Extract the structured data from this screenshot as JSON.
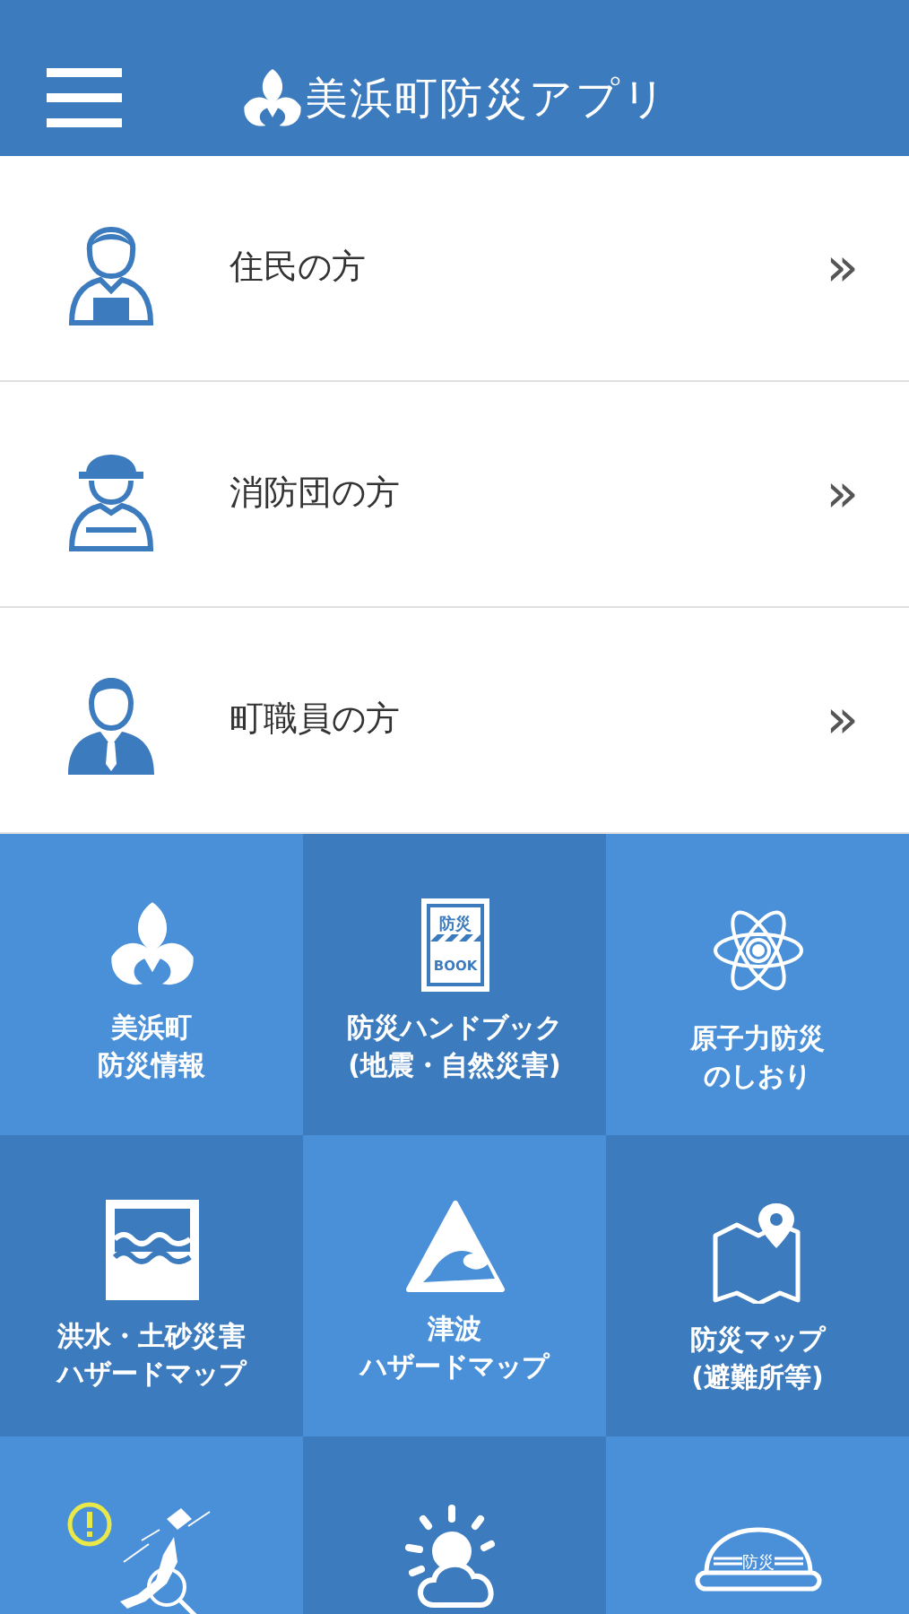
{
  "header": {
    "title": "美浜町防災アプリ"
  },
  "menu": [
    {
      "kind": "resident",
      "label": "住民の方",
      "chevron": "»"
    },
    {
      "kind": "firefighter",
      "label": "消防団の方",
      "chevron": "»"
    },
    {
      "kind": "staff",
      "label": "町職員の方",
      "chevron": "»"
    }
  ],
  "tiles": [
    {
      "kind": "emblem",
      "lines": [
        "美浜町",
        "防災情報"
      ]
    },
    {
      "kind": "book",
      "icon_text": [
        "防災",
        "BOOK"
      ],
      "lines": [
        "防災ハンドブック",
        "(地震・自然災害)"
      ]
    },
    {
      "kind": "atom",
      "lines": [
        "原子力防災",
        "のしおり"
      ]
    },
    {
      "kind": "flood",
      "lines": [
        "洪水・土砂災害",
        "ハザードマップ"
      ]
    },
    {
      "kind": "tsunami",
      "lines": [
        "津波",
        "ハザードマップ"
      ]
    },
    {
      "kind": "map",
      "lines": [
        "防災マップ",
        "(避難所等)"
      ]
    },
    {
      "kind": "alert-map"
    },
    {
      "kind": "weather"
    },
    {
      "kind": "helmet",
      "icon_text": [
        "防災"
      ]
    }
  ]
}
